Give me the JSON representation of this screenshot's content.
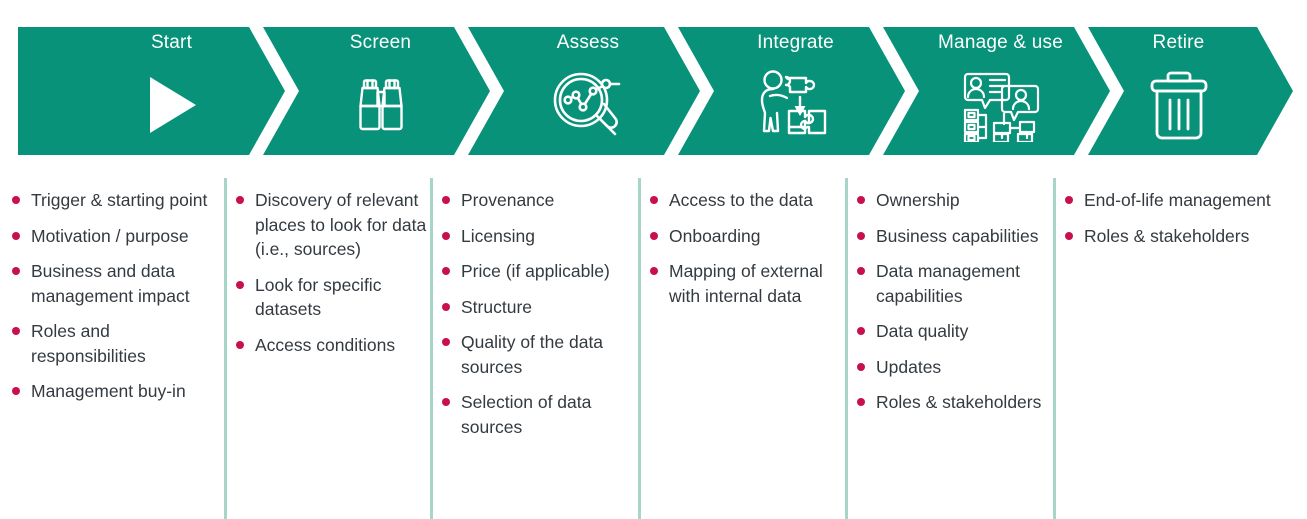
{
  "colors": {
    "stage_fill": "#089279",
    "bullet": "#c8104e",
    "text": "#333a40",
    "divider": "#a7d5c9",
    "label_text": "#ffffff",
    "background": "#ffffff"
  },
  "banner": {
    "stages": [
      {
        "label": "Start",
        "icon": "play-icon"
      },
      {
        "label": "Screen",
        "icon": "binoculars-icon"
      },
      {
        "label": "Assess",
        "icon": "magnifier-chart-icon"
      },
      {
        "label": "Integrate",
        "icon": "person-puzzle-icon"
      },
      {
        "label": "Manage & use",
        "icon": "people-network-icon"
      },
      {
        "label": "Retire",
        "icon": "trash-icon"
      }
    ]
  },
  "columns": [
    {
      "stage": "Start",
      "items": [
        "Trigger & starting point",
        "Motivation / purpose",
        "Business and data management impact",
        "Roles and responsibilities",
        "Management buy-in"
      ]
    },
    {
      "stage": "Screen",
      "items": [
        "Discovery of relevant places to look for data (i.e., sources)",
        "Look for specific datasets",
        "Access conditions"
      ]
    },
    {
      "stage": "Assess",
      "items": [
        "Provenance",
        "Licensing",
        "Price (if applicable)",
        "Structure",
        "Quality of the data sources",
        "Selection of data sources"
      ]
    },
    {
      "stage": "Integrate",
      "items": [
        "Access to the data",
        "Onboarding",
        "Mapping of external with internal data"
      ]
    },
    {
      "stage": "Manage & use",
      "items": [
        "Ownership",
        "Business capabilities",
        "Data management capabilities",
        "Data quality",
        "Updates",
        "Roles & stakeholders"
      ]
    },
    {
      "stage": "Retire",
      "items": [
        "End-of-life management",
        "Roles & stakeholders"
      ]
    }
  ]
}
